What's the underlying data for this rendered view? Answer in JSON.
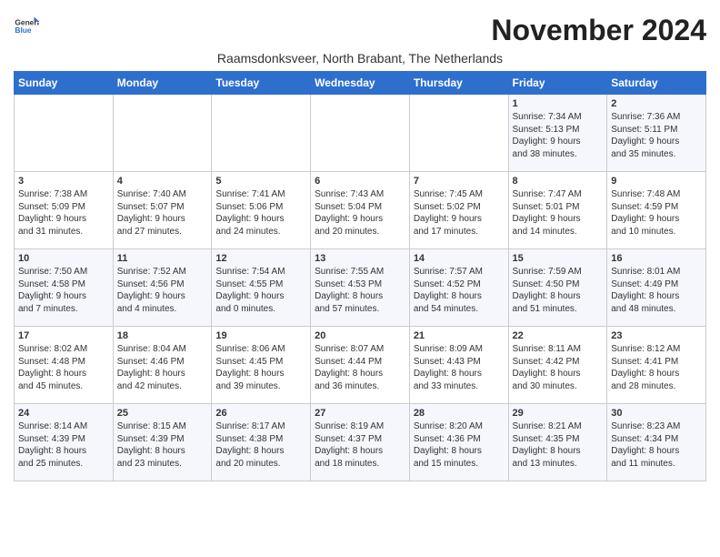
{
  "logo": {
    "general": "General",
    "blue": "Blue"
  },
  "title": "November 2024",
  "subtitle": "Raamsdonksveer, North Brabant, The Netherlands",
  "days_header": [
    "Sunday",
    "Monday",
    "Tuesday",
    "Wednesday",
    "Thursday",
    "Friday",
    "Saturday"
  ],
  "weeks": [
    [
      {
        "day": "",
        "info": ""
      },
      {
        "day": "",
        "info": ""
      },
      {
        "day": "",
        "info": ""
      },
      {
        "day": "",
        "info": ""
      },
      {
        "day": "",
        "info": ""
      },
      {
        "day": "1",
        "info": "Sunrise: 7:34 AM\nSunset: 5:13 PM\nDaylight: 9 hours\nand 38 minutes."
      },
      {
        "day": "2",
        "info": "Sunrise: 7:36 AM\nSunset: 5:11 PM\nDaylight: 9 hours\nand 35 minutes."
      }
    ],
    [
      {
        "day": "3",
        "info": "Sunrise: 7:38 AM\nSunset: 5:09 PM\nDaylight: 9 hours\nand 31 minutes."
      },
      {
        "day": "4",
        "info": "Sunrise: 7:40 AM\nSunset: 5:07 PM\nDaylight: 9 hours\nand 27 minutes."
      },
      {
        "day": "5",
        "info": "Sunrise: 7:41 AM\nSunset: 5:06 PM\nDaylight: 9 hours\nand 24 minutes."
      },
      {
        "day": "6",
        "info": "Sunrise: 7:43 AM\nSunset: 5:04 PM\nDaylight: 9 hours\nand 20 minutes."
      },
      {
        "day": "7",
        "info": "Sunrise: 7:45 AM\nSunset: 5:02 PM\nDaylight: 9 hours\nand 17 minutes."
      },
      {
        "day": "8",
        "info": "Sunrise: 7:47 AM\nSunset: 5:01 PM\nDaylight: 9 hours\nand 14 minutes."
      },
      {
        "day": "9",
        "info": "Sunrise: 7:48 AM\nSunset: 4:59 PM\nDaylight: 9 hours\nand 10 minutes."
      }
    ],
    [
      {
        "day": "10",
        "info": "Sunrise: 7:50 AM\nSunset: 4:58 PM\nDaylight: 9 hours\nand 7 minutes."
      },
      {
        "day": "11",
        "info": "Sunrise: 7:52 AM\nSunset: 4:56 PM\nDaylight: 9 hours\nand 4 minutes."
      },
      {
        "day": "12",
        "info": "Sunrise: 7:54 AM\nSunset: 4:55 PM\nDaylight: 9 hours\nand 0 minutes."
      },
      {
        "day": "13",
        "info": "Sunrise: 7:55 AM\nSunset: 4:53 PM\nDaylight: 8 hours\nand 57 minutes."
      },
      {
        "day": "14",
        "info": "Sunrise: 7:57 AM\nSunset: 4:52 PM\nDaylight: 8 hours\nand 54 minutes."
      },
      {
        "day": "15",
        "info": "Sunrise: 7:59 AM\nSunset: 4:50 PM\nDaylight: 8 hours\nand 51 minutes."
      },
      {
        "day": "16",
        "info": "Sunrise: 8:01 AM\nSunset: 4:49 PM\nDaylight: 8 hours\nand 48 minutes."
      }
    ],
    [
      {
        "day": "17",
        "info": "Sunrise: 8:02 AM\nSunset: 4:48 PM\nDaylight: 8 hours\nand 45 minutes."
      },
      {
        "day": "18",
        "info": "Sunrise: 8:04 AM\nSunset: 4:46 PM\nDaylight: 8 hours\nand 42 minutes."
      },
      {
        "day": "19",
        "info": "Sunrise: 8:06 AM\nSunset: 4:45 PM\nDaylight: 8 hours\nand 39 minutes."
      },
      {
        "day": "20",
        "info": "Sunrise: 8:07 AM\nSunset: 4:44 PM\nDaylight: 8 hours\nand 36 minutes."
      },
      {
        "day": "21",
        "info": "Sunrise: 8:09 AM\nSunset: 4:43 PM\nDaylight: 8 hours\nand 33 minutes."
      },
      {
        "day": "22",
        "info": "Sunrise: 8:11 AM\nSunset: 4:42 PM\nDaylight: 8 hours\nand 30 minutes."
      },
      {
        "day": "23",
        "info": "Sunrise: 8:12 AM\nSunset: 4:41 PM\nDaylight: 8 hours\nand 28 minutes."
      }
    ],
    [
      {
        "day": "24",
        "info": "Sunrise: 8:14 AM\nSunset: 4:39 PM\nDaylight: 8 hours\nand 25 minutes."
      },
      {
        "day": "25",
        "info": "Sunrise: 8:15 AM\nSunset: 4:39 PM\nDaylight: 8 hours\nand 23 minutes."
      },
      {
        "day": "26",
        "info": "Sunrise: 8:17 AM\nSunset: 4:38 PM\nDaylight: 8 hours\nand 20 minutes."
      },
      {
        "day": "27",
        "info": "Sunrise: 8:19 AM\nSunset: 4:37 PM\nDaylight: 8 hours\nand 18 minutes."
      },
      {
        "day": "28",
        "info": "Sunrise: 8:20 AM\nSunset: 4:36 PM\nDaylight: 8 hours\nand 15 minutes."
      },
      {
        "day": "29",
        "info": "Sunrise: 8:21 AM\nSunset: 4:35 PM\nDaylight: 8 hours\nand 13 minutes."
      },
      {
        "day": "30",
        "info": "Sunrise: 8:23 AM\nSunset: 4:34 PM\nDaylight: 8 hours\nand 11 minutes."
      }
    ]
  ]
}
